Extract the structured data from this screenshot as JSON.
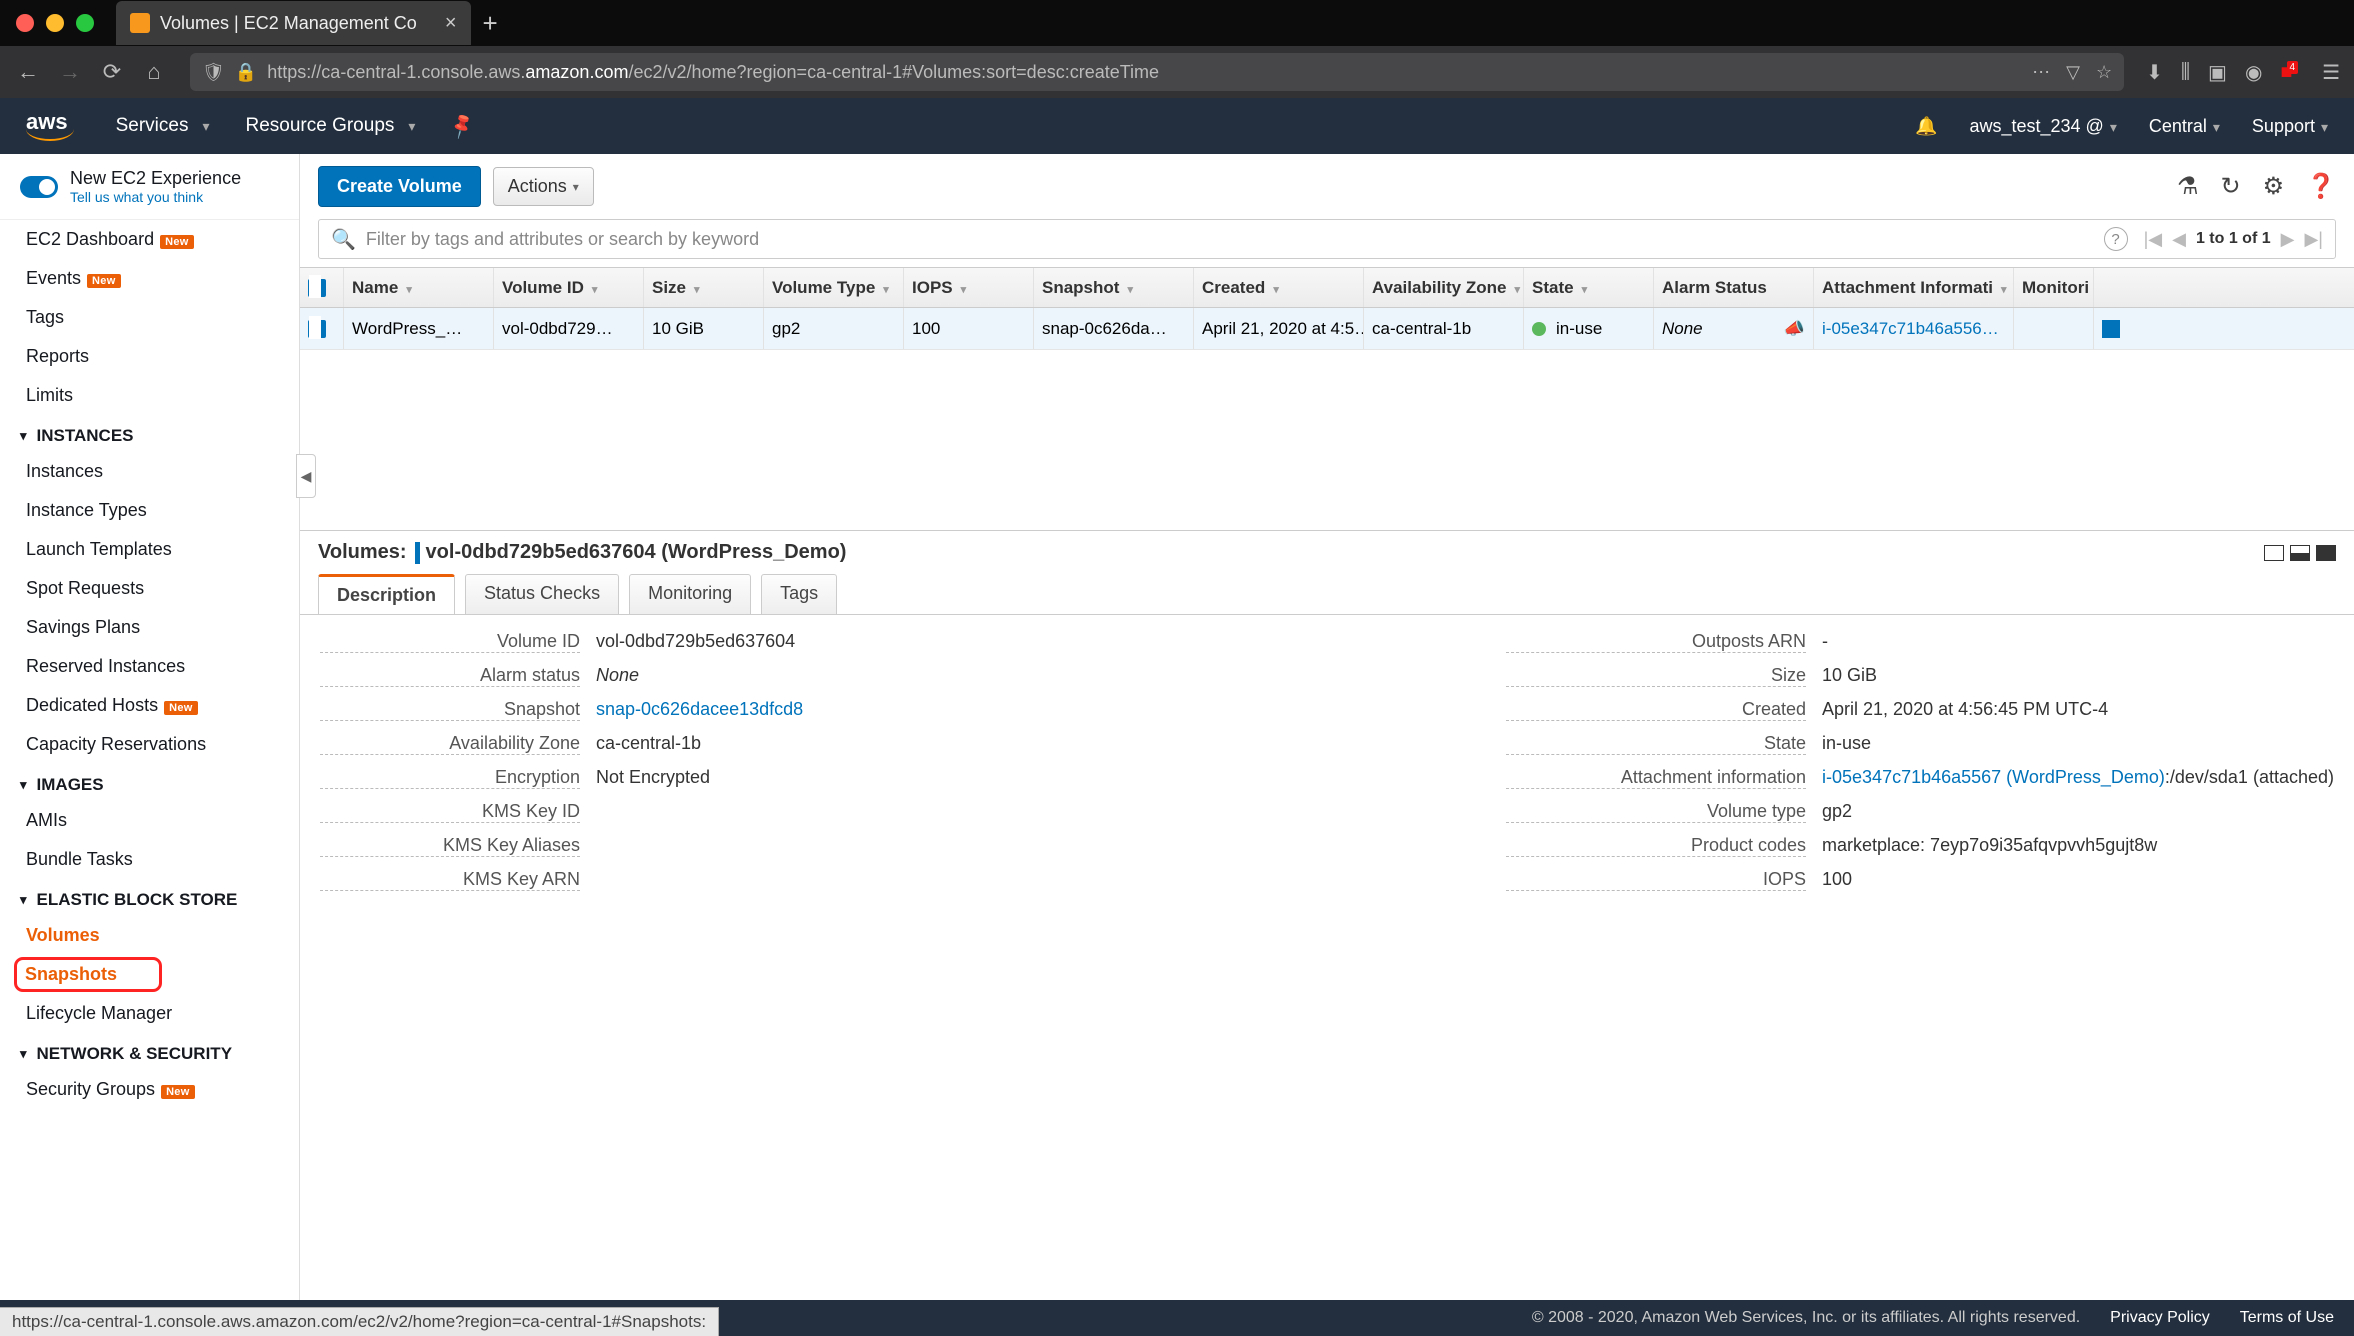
{
  "browser": {
    "tab_title": "Volumes | EC2 Management Co",
    "url_prefix": "https://ca-central-1.console.aws.",
    "url_domain": "amazon.com",
    "url_suffix": "/ec2/v2/home?region=ca-central-1#Volumes:sort=desc:createTime",
    "ext_badge": "4"
  },
  "header": {
    "logo": "aws",
    "services": "Services",
    "resource_groups": "Resource Groups",
    "account": "aws_test_234 @",
    "region": "Central",
    "support": "Support"
  },
  "new_exp": {
    "title": "New EC2 Experience",
    "sub": "Tell us what you think"
  },
  "sidebar": {
    "dashboard": "EC2 Dashboard",
    "events": "Events",
    "tags": "Tags",
    "reports": "Reports",
    "limits": "Limits",
    "sec_instances": "INSTANCES",
    "instances": "Instances",
    "instance_types": "Instance Types",
    "launch_templates": "Launch Templates",
    "spot": "Spot Requests",
    "savings": "Savings Plans",
    "reserved": "Reserved Instances",
    "dedicated": "Dedicated Hosts",
    "capacity": "Capacity Reservations",
    "sec_images": "IMAGES",
    "amis": "AMIs",
    "bundle": "Bundle Tasks",
    "sec_ebs": "ELASTIC BLOCK STORE",
    "volumes": "Volumes",
    "snapshots": "Snapshots",
    "lifecycle": "Lifecycle Manager",
    "sec_net": "NETWORK & SECURITY",
    "secgroups": "Security Groups",
    "badge_new": "New"
  },
  "toolbar": {
    "create": "Create Volume",
    "actions": "Actions"
  },
  "search": {
    "placeholder": "Filter by tags and attributes or search by keyword"
  },
  "pager": {
    "range": "1 to 1 of 1"
  },
  "table": {
    "cols": [
      "Name",
      "Volume ID",
      "Size",
      "Volume Type",
      "IOPS",
      "Snapshot",
      "Created",
      "Availability Zone",
      "State",
      "Alarm Status",
      "Attachment Informati",
      "Monitori"
    ],
    "row": {
      "name": "WordPress_…",
      "volid": "vol-0dbd729…",
      "size": "10 GiB",
      "vtype": "gp2",
      "iops": "100",
      "snap": "snap-0c626da…",
      "created": "April 21, 2020 at 4:5…",
      "az": "ca-central-1b",
      "state": "in-use",
      "alarm": "None",
      "attach": "i-05e347c71b46a556…"
    }
  },
  "detail": {
    "prefix": "Volumes:",
    "selected": "vol-0dbd729b5ed637604 (WordPress_Demo)",
    "tabs": {
      "desc": "Description",
      "status": "Status Checks",
      "mon": "Monitoring",
      "tags": "Tags"
    },
    "left": {
      "volid_k": "Volume ID",
      "volid_v": "vol-0dbd729b5ed637604",
      "alarm_k": "Alarm status",
      "alarm_v": "None",
      "snap_k": "Snapshot",
      "snap_v": "snap-0c626dacee13dfcd8",
      "az_k": "Availability Zone",
      "az_v": "ca-central-1b",
      "enc_k": "Encryption",
      "enc_v": "Not Encrypted",
      "kmsid_k": "KMS Key ID",
      "kmsid_v": "",
      "kmsalias_k": "KMS Key Aliases",
      "kmsalias_v": "",
      "kmsarn_k": "KMS Key ARN",
      "kmsarn_v": ""
    },
    "right": {
      "outpost_k": "Outposts ARN",
      "outpost_v": "-",
      "size_k": "Size",
      "size_v": "10 GiB",
      "created_k": "Created",
      "created_v": "April 21, 2020 at 4:56:45 PM UTC-4",
      "state_k": "State",
      "state_v": "in-use",
      "attach_k": "Attachment information",
      "attach_link": "i-05e347c71b46a5567 (WordPress_Demo)",
      "attach_suffix": ":/dev/sda1 (attached)",
      "vtype_k": "Volume type",
      "vtype_v": "gp2",
      "prod_k": "Product codes",
      "prod_v": "marketplace: 7eyp7o9i35afqvpvvh5gujt8w",
      "iops_k": "IOPS",
      "iops_v": "100"
    }
  },
  "footer": {
    "copyright": "© 2008 - 2020, Amazon Web Services, Inc. or its affiliates. All rights reserved.",
    "privacy": "Privacy Policy",
    "terms": "Terms of Use"
  },
  "status_url": "https://ca-central-1.console.aws.amazon.com/ec2/v2/home?region=ca-central-1#Snapshots:"
}
